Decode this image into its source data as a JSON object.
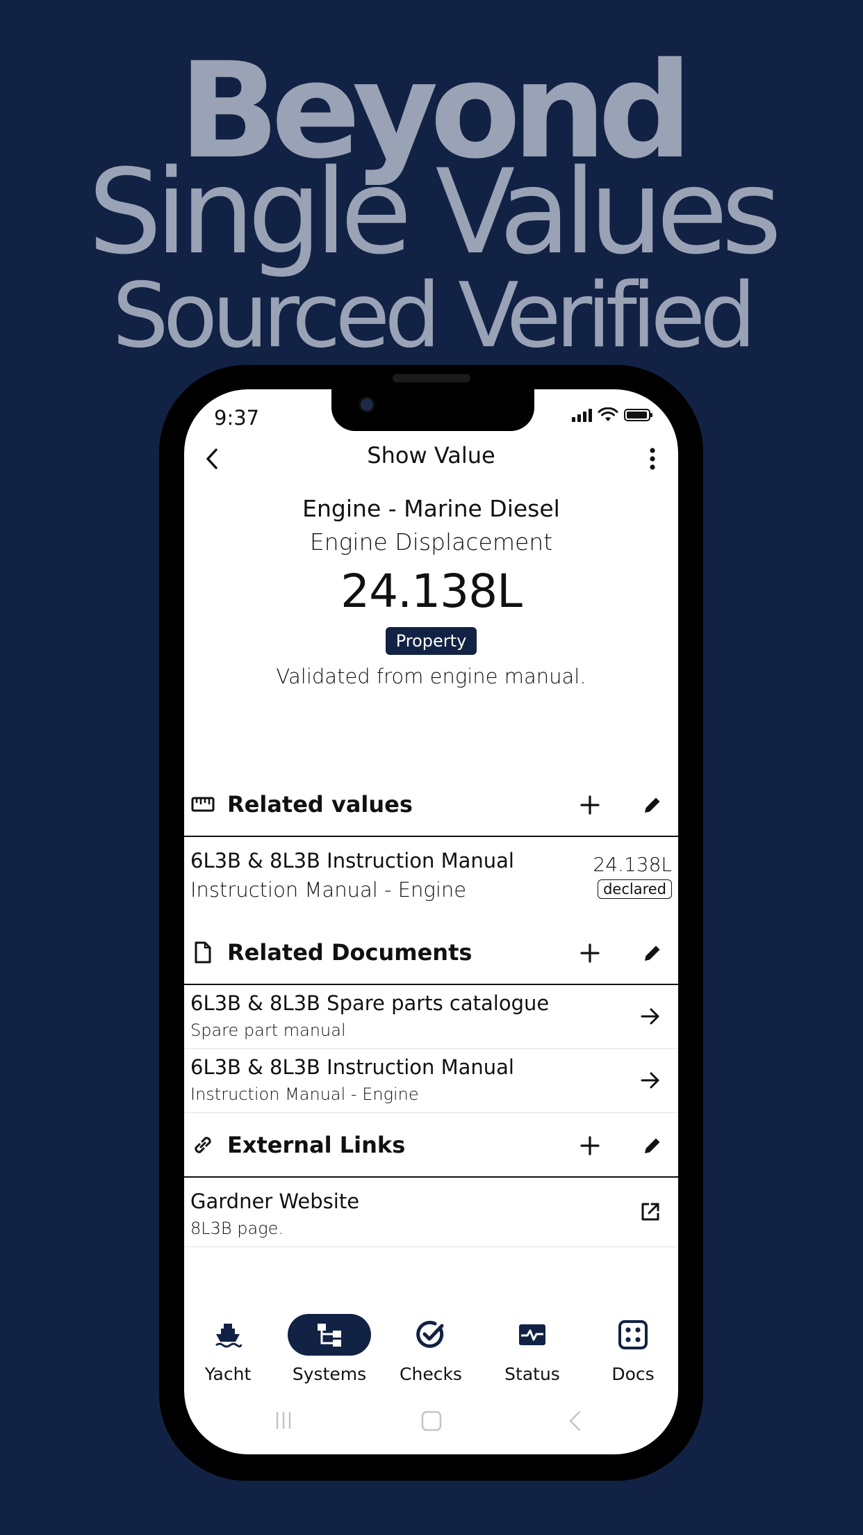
{
  "promo": {
    "line1": "Beyond",
    "line2": "Single Values",
    "line3": "Sourced Verified"
  },
  "status_bar": {
    "time": "9:37"
  },
  "topbar": {
    "title": "Show Value"
  },
  "value": {
    "system": "Engine - Marine Diesel",
    "name": "Engine Displacement",
    "amount": "24.138L",
    "badge": "Property",
    "note": "Validated from engine manual."
  },
  "sections": {
    "related_values": {
      "title": "Related values",
      "items": [
        {
          "title": "6L3B & 8L3B Instruction Manual",
          "subtitle": "Instruction Manual - Engine",
          "value": "24.138L",
          "tag": "declared"
        }
      ]
    },
    "related_documents": {
      "title": "Related Documents",
      "items": [
        {
          "title": "6L3B & 8L3B Spare parts catalogue",
          "subtitle": "Spare part manual"
        },
        {
          "title": "6L3B & 8L3B Instruction Manual",
          "subtitle": "Instruction Manual - Engine"
        }
      ]
    },
    "external_links": {
      "title": "External Links",
      "items": [
        {
          "title": "Gardner Website",
          "subtitle": "8L3B page."
        }
      ]
    }
  },
  "bottom_nav": {
    "items": [
      {
        "label": "Yacht",
        "icon": "yacht-icon"
      },
      {
        "label": "Systems",
        "icon": "systems-icon",
        "active": true
      },
      {
        "label": "Checks",
        "icon": "checks-icon"
      },
      {
        "label": "Status",
        "icon": "status-icon"
      },
      {
        "label": "Docs",
        "icon": "docs-icon"
      }
    ]
  },
  "colors": {
    "brand": "#122244",
    "headline": "#9aa3b6",
    "text": "#111111"
  }
}
